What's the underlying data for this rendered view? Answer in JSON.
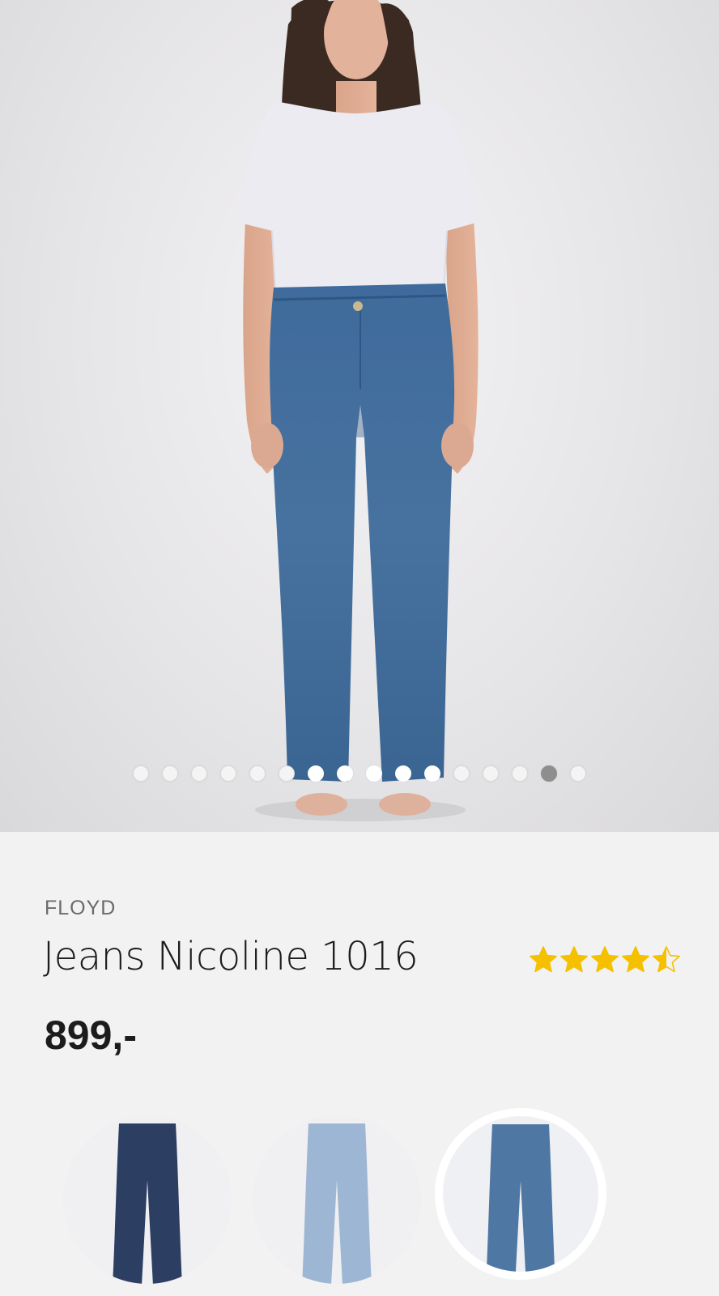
{
  "hero": {
    "image_alt": "model-wearing-jeans",
    "carousel": {
      "count": 16,
      "active_index": 14
    }
  },
  "product": {
    "brand": "FLOYD",
    "title": "Jeans Nicoline 1016",
    "price": "899,-",
    "rating": 4.5,
    "rating_max": 5,
    "star_color": "#f5c000"
  },
  "variants": [
    {
      "name": "dark-blue",
      "color": "#2d3e63",
      "selected": false
    },
    {
      "name": "light-blue",
      "color": "#9db6d4",
      "selected": false
    },
    {
      "name": "mid-blue",
      "color": "#4f77a3",
      "selected": true
    }
  ]
}
